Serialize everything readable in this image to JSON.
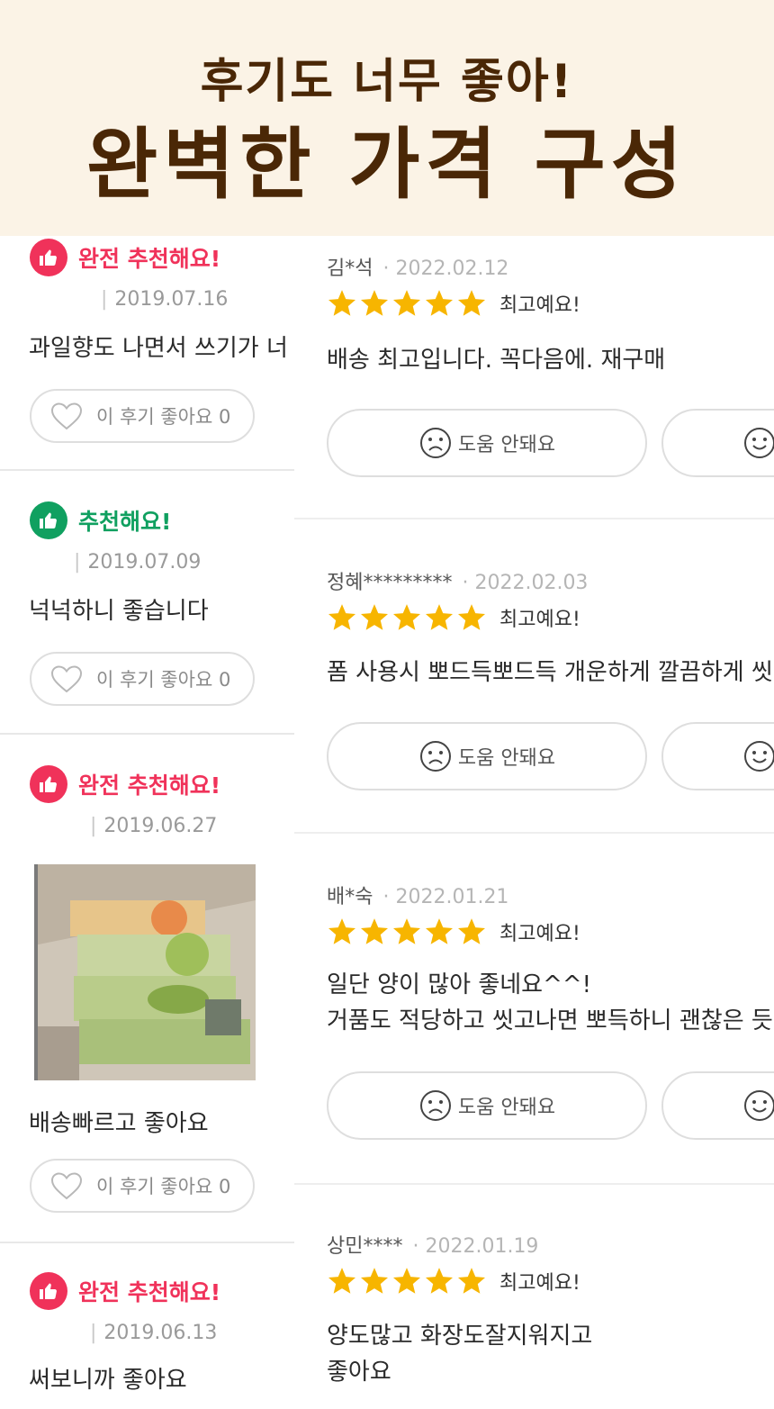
{
  "banner": {
    "subtitle": "후기도 너무 좋아!",
    "title": "완벽한 가격 구성"
  },
  "left_reviews": [
    {
      "badge": "완전 추천해요!",
      "badge_color": "#f0325a",
      "date": "2019.07.16",
      "comment": "과일향도 나면서 쓰기가 너",
      "like_label": "이 후기 좋아요 0"
    },
    {
      "badge": "추천해요!",
      "badge_color": "#10a060",
      "date": "2019.07.09",
      "comment": "넉넉하니 좋습니다",
      "like_label": "이 후기 좋아요 0"
    },
    {
      "badge": "완전 추천해요!",
      "badge_color": "#f0325a",
      "date": "2019.06.27",
      "comment": "배송빠르고 좋아요",
      "like_label": "이 후기 좋아요 0"
    },
    {
      "badge": "완전 추천해요!",
      "badge_color": "#f0325a",
      "date": "2019.06.13",
      "comment": "써보니까 좋아요"
    }
  ],
  "right_reviews": [
    {
      "name": "김*석",
      "date": "· 2022.02.12",
      "stars": 5,
      "rating_label": "최고예요!",
      "text": [
        "배송 최고입니다. 꼭다음에. 재구매"
      ],
      "help_label": "도움 안돼요"
    },
    {
      "name": "정혜*********",
      "date": "· 2022.02.03",
      "stars": 5,
      "rating_label": "최고예요!",
      "text": [
        "폼 사용시 뽀드득뽀드득 개운하게 깔끔하게 씻겨"
      ],
      "help_label": "도움 안돼요"
    },
    {
      "name": "배*숙",
      "date": "· 2022.01.21",
      "stars": 5,
      "rating_label": "최고예요!",
      "text": [
        "일단 양이 많아 좋네요^^!",
        "거품도 적당하고 씻고나면 뽀득하니 괜찮은 듯 해"
      ],
      "help_label": "도움 안돼요"
    },
    {
      "name": "상민****",
      "date": "· 2022.01.19",
      "stars": 5,
      "rating_label": "최고예요!",
      "text": [
        "양도많고 화장도잘지워지고",
        "좋아요"
      ]
    }
  ],
  "colors": {
    "banner_bg": "#fbf3e6",
    "banner_text": "#4a2706",
    "star": "#f7b500",
    "recommend_pink": "#f0325a",
    "recommend_green": "#10a060"
  },
  "icons": {
    "badge": "thumbs-up-icon",
    "like": "heart-outline-icon",
    "help": "sad-face-icon",
    "help_secondary": "smile-face-icon",
    "rating": "star-icon"
  }
}
